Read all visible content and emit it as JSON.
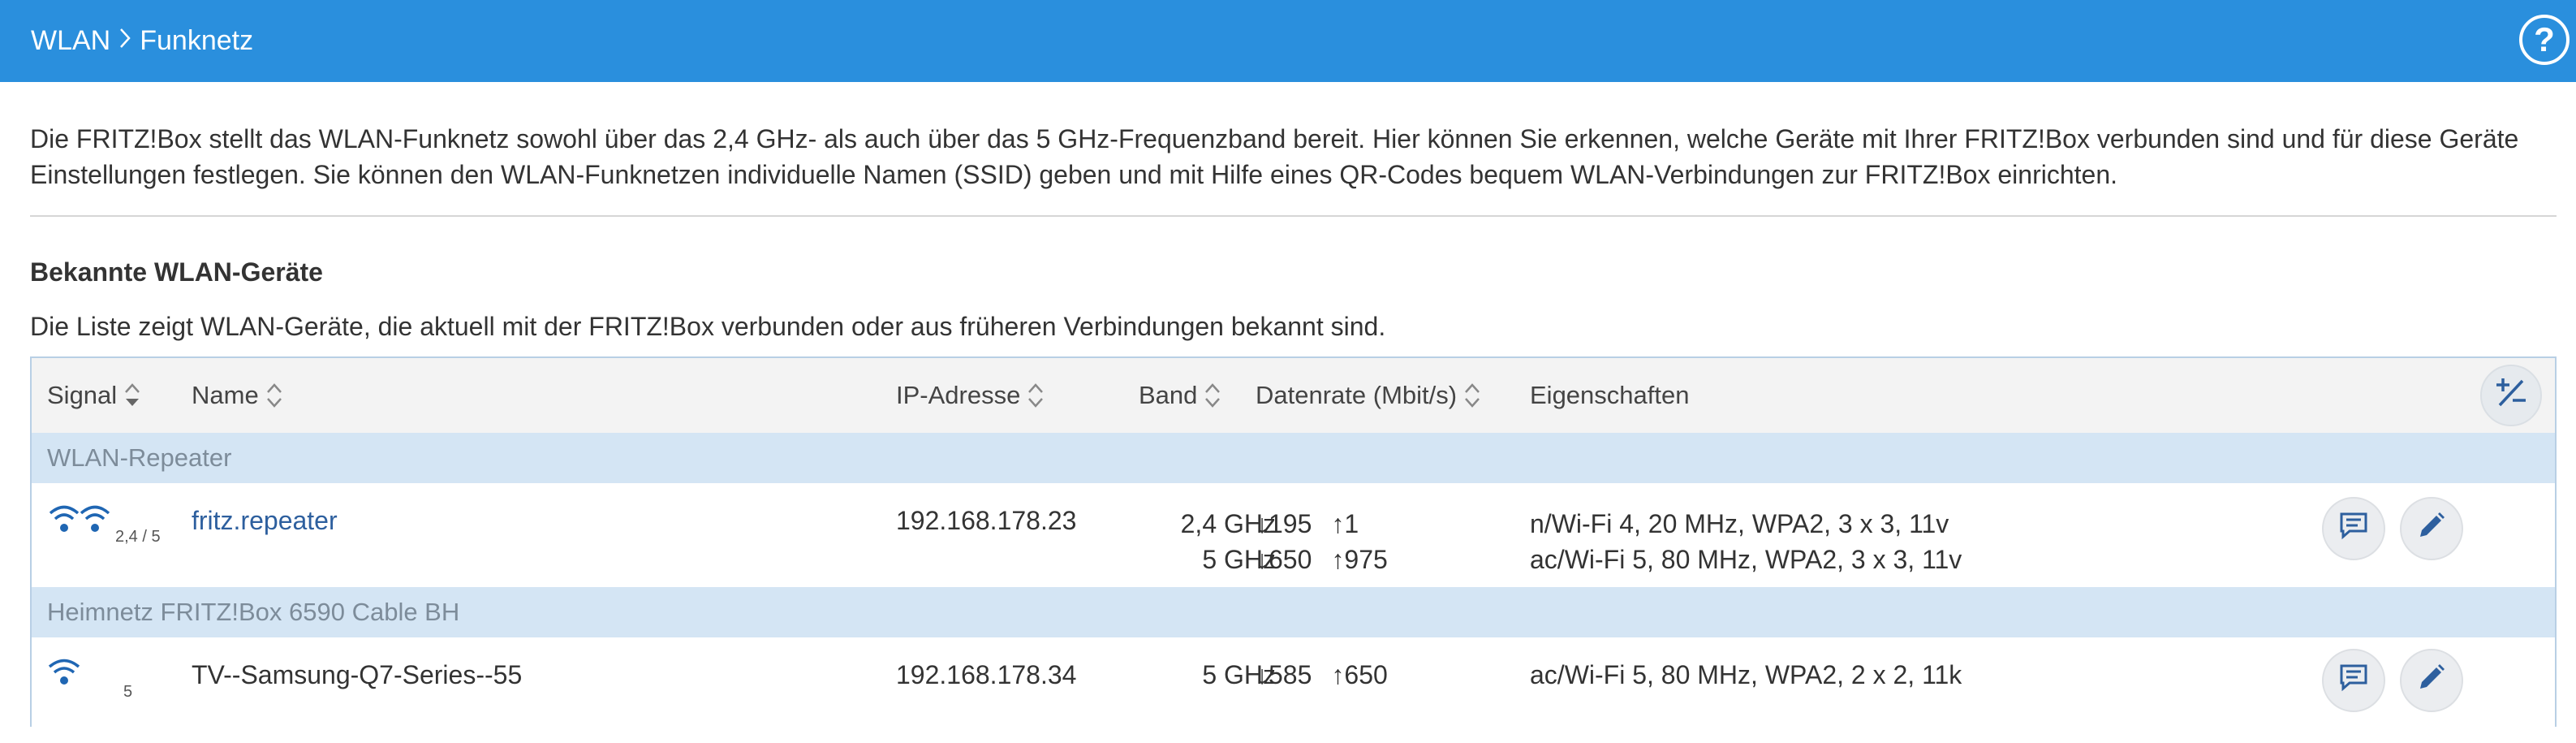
{
  "header": {
    "breadcrumb_parent": "WLAN",
    "breadcrumb_current": "Funknetz",
    "help_label": "?"
  },
  "intro_text": "Die FRITZ!Box stellt das WLAN-Funknetz sowohl über das 2,4 GHz- als auch über das 5 GHz-Frequenzband bereit. Hier können Sie erkennen, welche Geräte mit Ihrer FRITZ!Box verbunden sind und für diese Geräte Einstellungen festlegen. Sie können den WLAN-Funknetzen individuelle Namen (SSID) geben und mit Hilfe eines QR-Codes bequem WLAN-Verbindungen zur FRITZ!Box einrichten.",
  "section": {
    "title": "Bekannte WLAN-Geräte",
    "description": "Die Liste zeigt WLAN-Geräte, die aktuell mit der FRITZ!Box verbunden oder aus früheren Verbindungen bekannt sind."
  },
  "table": {
    "columns": {
      "signal": "Signal",
      "name": "Name",
      "ip": "IP-Adresse",
      "band": "Band",
      "rate": "Datenrate (Mbit/s)",
      "props": "Eigenschaften"
    },
    "groups": [
      {
        "label": "WLAN-Repeater",
        "device": {
          "signal_band": "2,4 / 5",
          "name": "fritz.repeater",
          "ip": "192.168.178.23",
          "bands": [
            "2,4 GHz",
            "5 GHz"
          ],
          "rates": [
            {
              "down": "↓195",
              "up": "↑1"
            },
            {
              "down": "↓650",
              "up": "↑975"
            }
          ],
          "props": [
            "n/Wi-Fi 4, 20 MHz, WPA2, 3 x 3, 11v",
            "ac/Wi-Fi 5, 80 MHz, WPA2, 3 x 3, 11v"
          ]
        }
      },
      {
        "label": "Heimnetz FRITZ!Box 6590 Cable BH",
        "device": {
          "signal_band": "5",
          "name": "TV--Samsung-Q7-Series--55",
          "ip": "192.168.178.34",
          "bands": [
            "5 GHz"
          ],
          "rates": [
            {
              "down": "↓585",
              "up": "↑650"
            }
          ],
          "props": [
            "ac/Wi-Fi 5, 80 MHz, WPA2, 2 x 2, 11k"
          ]
        }
      }
    ]
  },
  "icons": {
    "help": "help-icon",
    "chevron": "chevron-right-icon",
    "sort": "sort-icon",
    "plusminus": "plus-minus-icon",
    "wifi": "wifi-icon",
    "message": "message-icon",
    "edit": "pencil-icon"
  },
  "colors": {
    "header_bg": "#2a8fdd",
    "group_bg": "#d4e5f4",
    "link": "#2d5f9e",
    "wifi": "#1f66b3"
  }
}
